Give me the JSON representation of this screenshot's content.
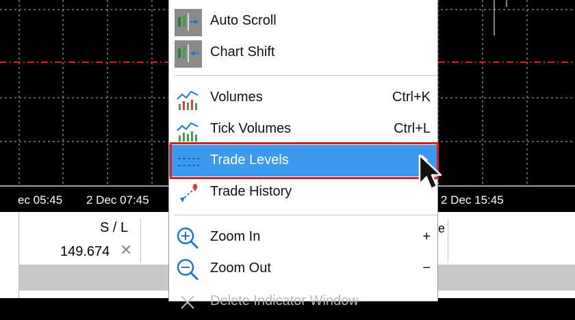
{
  "chart": {
    "time_labels": [
      "ec 05:45",
      "2 Dec 07:45",
      "2 Dec 15:45"
    ],
    "colors": {
      "background": "#000000",
      "grid": "#c8c8c8",
      "level_line": "#e01818"
    }
  },
  "terminal": {
    "column_header": "S / L",
    "row_value": "149.674",
    "remove_icon": "✕",
    "right_fragment": "e"
  },
  "menu": {
    "items": [
      {
        "label": "Auto Scroll",
        "icon": "auto-scroll-icon",
        "shortcut": ""
      },
      {
        "label": "Chart Shift",
        "icon": "chart-shift-icon",
        "shortcut": ""
      },
      {
        "label": "Volumes",
        "icon": "volumes-icon",
        "shortcut": "Ctrl+K"
      },
      {
        "label": "Tick Volumes",
        "icon": "tick-volumes-icon",
        "shortcut": "Ctrl+L"
      },
      {
        "label": "Trade Levels",
        "icon": "trade-levels-icon",
        "shortcut": "",
        "selected": true,
        "has_submenu": true
      },
      {
        "label": "Trade History",
        "icon": "trade-history-icon",
        "shortcut": ""
      },
      {
        "label": "Zoom In",
        "icon": "zoom-in-icon",
        "shortcut": "+"
      },
      {
        "label": "Zoom Out",
        "icon": "zoom-out-icon",
        "shortcut": "−"
      },
      {
        "label": "Delete Indicator Window",
        "icon": "delete-window-icon",
        "shortcut": "",
        "disabled": true
      }
    ],
    "colors": {
      "selected": "#3b9af0",
      "highlight_border": "#d92020"
    }
  }
}
